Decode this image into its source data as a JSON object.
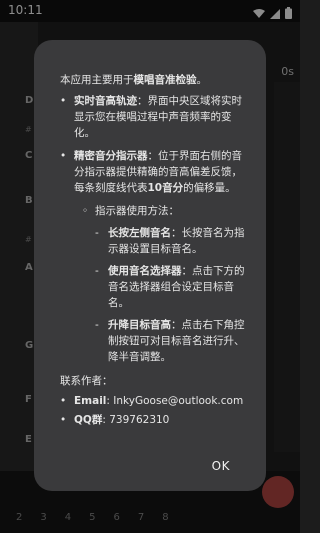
{
  "status_bar": {
    "time": "10:11",
    "icons": [
      "settings-icon",
      "wifi-icon",
      "signal-icon",
      "battery-icon"
    ]
  },
  "background": {
    "readout": "0s",
    "note_labels": [
      "D",
      "C",
      "B",
      "A",
      "G",
      "F",
      "E"
    ],
    "small_labels": [
      "#",
      "#",
      "#",
      "#",
      "#"
    ],
    "key_row": [
      "2",
      "3",
      "4",
      "5",
      "6",
      "7",
      "8"
    ],
    "accent_fab_color": "#d9534f"
  },
  "dialog": {
    "intro_prefix": "本应用主要用于",
    "intro_bold": "模唱音准检验",
    "intro_suffix": "。",
    "features": [
      {
        "title": "实时音高轨迹",
        "text": "：界面中央区域将实时显示您在模唱过程中声音频率的变化。"
      },
      {
        "title": "精密音分指示器",
        "text_before": "：位于界面右侧的音分指示器提供精确的音高偏差反馈，每条刻度线代表",
        "bold_mid": "10音分",
        "text_after": "的偏移量。"
      }
    ],
    "usage_title": "指示器使用方法：",
    "usage_items": [
      {
        "title": "长按左侧音名",
        "text": "：长按音名为指示器设置目标音名。"
      },
      {
        "title": "使用音名选择器",
        "text": "：点击下方的音名选择器组合设定目标音名。"
      },
      {
        "title": "升降目标音高",
        "text": "：点击右下角控制按钮可对目标音名进行升、降半音调整。"
      }
    ],
    "contact_title": "联系作者：",
    "contacts": [
      {
        "label": "Email",
        "value": ": InkyGoose@outlook.com"
      },
      {
        "label": "QQ群",
        "value": ": 739762310"
      }
    ],
    "ok_label": "OK"
  }
}
